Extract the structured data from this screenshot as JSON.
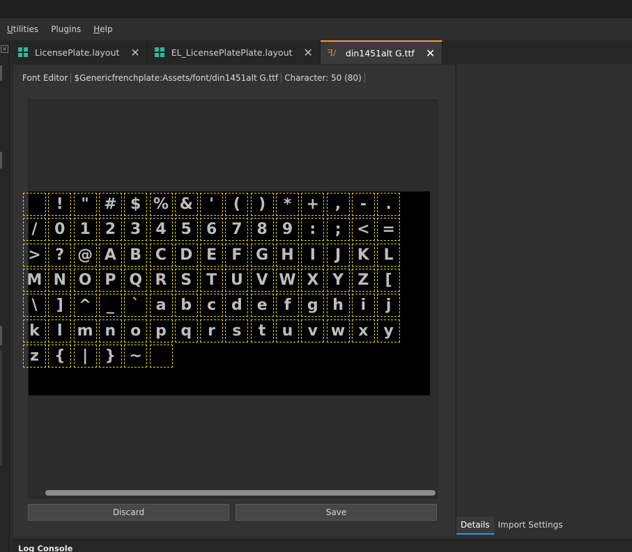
{
  "menu": [
    {
      "label": "Utilities",
      "accel": "U"
    },
    {
      "label": "Plugins",
      "accel": "g"
    },
    {
      "label": "Help",
      "accel": "H"
    }
  ],
  "tabs": [
    {
      "label": "LicensePlate.layout",
      "icon": "layout-icon",
      "active": false
    },
    {
      "label": "EL_LicensePlatePlate.layout",
      "icon": "layout-icon",
      "active": false
    },
    {
      "label": "din1451alt G.ttf",
      "icon": "font-file-icon",
      "active": true
    }
  ],
  "breadcrumb": {
    "editor": "Font Editor",
    "path": "$Genericfrenchplate:Assets/font/din1451alt G.ttf",
    "character": "Character: 50 (80)"
  },
  "glyph_rows": [
    [
      " ",
      "!",
      "\"",
      "#",
      "$",
      "%",
      "&",
      "'",
      "(",
      ")",
      "*",
      "+",
      ",",
      "-",
      "."
    ],
    [
      "/",
      "0",
      "1",
      "2",
      "3",
      "4",
      "5",
      "6",
      "7",
      "8",
      "9",
      ":",
      ";",
      "<",
      "="
    ],
    [
      ">",
      "?",
      "@",
      "A",
      "B",
      "C",
      "D",
      "E",
      "F",
      "G",
      "H",
      "I",
      "J",
      "K",
      "L"
    ],
    [
      "M",
      "N",
      "O",
      "P",
      "Q",
      "R",
      "S",
      "T",
      "U",
      "V",
      "W",
      "X",
      "Y",
      "Z",
      "["
    ],
    [
      "\\",
      "]",
      "^",
      "_",
      "`",
      "a",
      "b",
      "c",
      "d",
      "e",
      "f",
      "g",
      "h",
      "i",
      "j"
    ],
    [
      "k",
      "l",
      "m",
      "n",
      "o",
      "p",
      "q",
      "r",
      "s",
      "t",
      "u",
      "v",
      "w",
      "x",
      "y"
    ],
    [
      "z",
      "{",
      "|",
      "}",
      "~",
      ""
    ]
  ],
  "buttons": {
    "discard": "Discard",
    "save": "Save"
  },
  "right_tabs": [
    {
      "label": "Details",
      "active": true
    },
    {
      "label": "Import Settings",
      "active": false
    }
  ],
  "log_console": "Log Console",
  "colors": {
    "accent_tab": "#f0a030",
    "glyph_border": "#e6d21f",
    "details_underline": "#3d8fd6"
  }
}
